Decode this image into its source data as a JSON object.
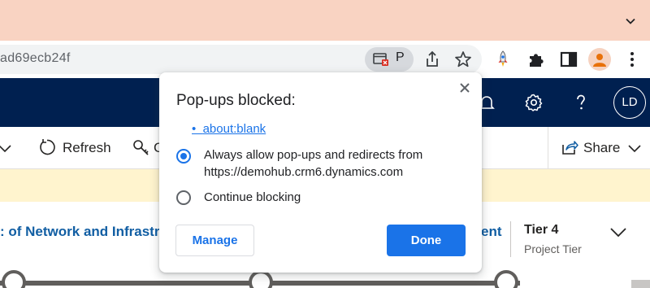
{
  "browser": {
    "url_fragment": "ad69ecb24f",
    "popup_indicator_letter": "P",
    "colors": {
      "tabstrip": "#f9d3c2",
      "omnibox": "#f1f3f4",
      "accent": "#1a73e8"
    }
  },
  "toolbar_icons": [
    "popup-blocked-icon",
    "share-page-icon",
    "bookmark-star-icon",
    "rocket-extension-icon",
    "puzzle-extensions-icon",
    "side-panel-icon",
    "profile-avatar-icon",
    "more-menu-icon"
  ],
  "app_header": {
    "user_initials": "LD",
    "icons": [
      "notification-bell-icon",
      "settings-gear-icon",
      "help-question-icon"
    ],
    "color": "#002050"
  },
  "command_bar": {
    "refresh_label": "Refresh",
    "partial_label": "C",
    "share_label": "Share"
  },
  "record": {
    "title_partial": ": of Network and Infrastru",
    "title_right_partial": "ent",
    "tier_value": "Tier 4",
    "tier_label": "Project Tier"
  },
  "popup_dialog": {
    "title": "Pop-ups blocked:",
    "blocked_items": [
      "about:blank"
    ],
    "options": [
      {
        "line1": "Always allow pop-ups and redirects from",
        "line2": "https://demohub.crm6.dynamics.com",
        "selected": true
      },
      {
        "line1": "Continue blocking",
        "selected": false
      }
    ],
    "manage_label": "Manage",
    "done_label": "Done"
  }
}
